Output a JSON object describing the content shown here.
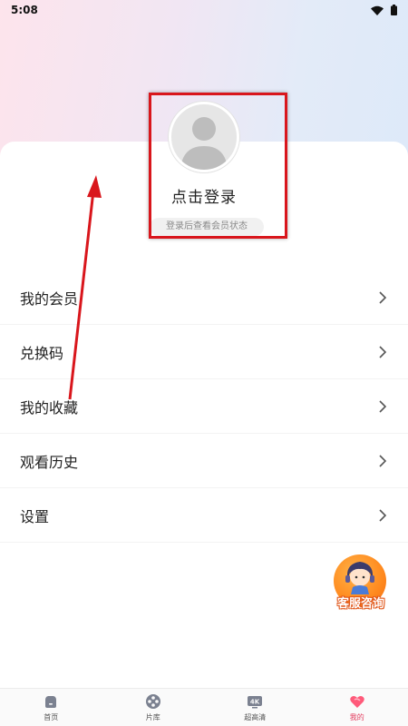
{
  "status_bar": {
    "time": "5:08"
  },
  "profile": {
    "login_title": "点击登录",
    "login_hint": "登录后查看会员状态"
  },
  "menu": [
    {
      "label": "我的会员"
    },
    {
      "label": "兑换码"
    },
    {
      "label": "我的收藏"
    },
    {
      "label": "观看历史"
    },
    {
      "label": "设置"
    }
  ],
  "customer_service": {
    "label": "客服咨询"
  },
  "tabbar": {
    "tabs": [
      {
        "label": "首页",
        "icon": "home-icon"
      },
      {
        "label": "片库",
        "icon": "film-reel-icon"
      },
      {
        "label": "超高清",
        "icon": "4k-icon"
      },
      {
        "label": "我的",
        "icon": "heart-icon",
        "active": true
      }
    ]
  },
  "colors": {
    "accent_active": "#e23a5c",
    "annotation_red": "#d9161c",
    "cs_orange": "#ff8a1f"
  }
}
